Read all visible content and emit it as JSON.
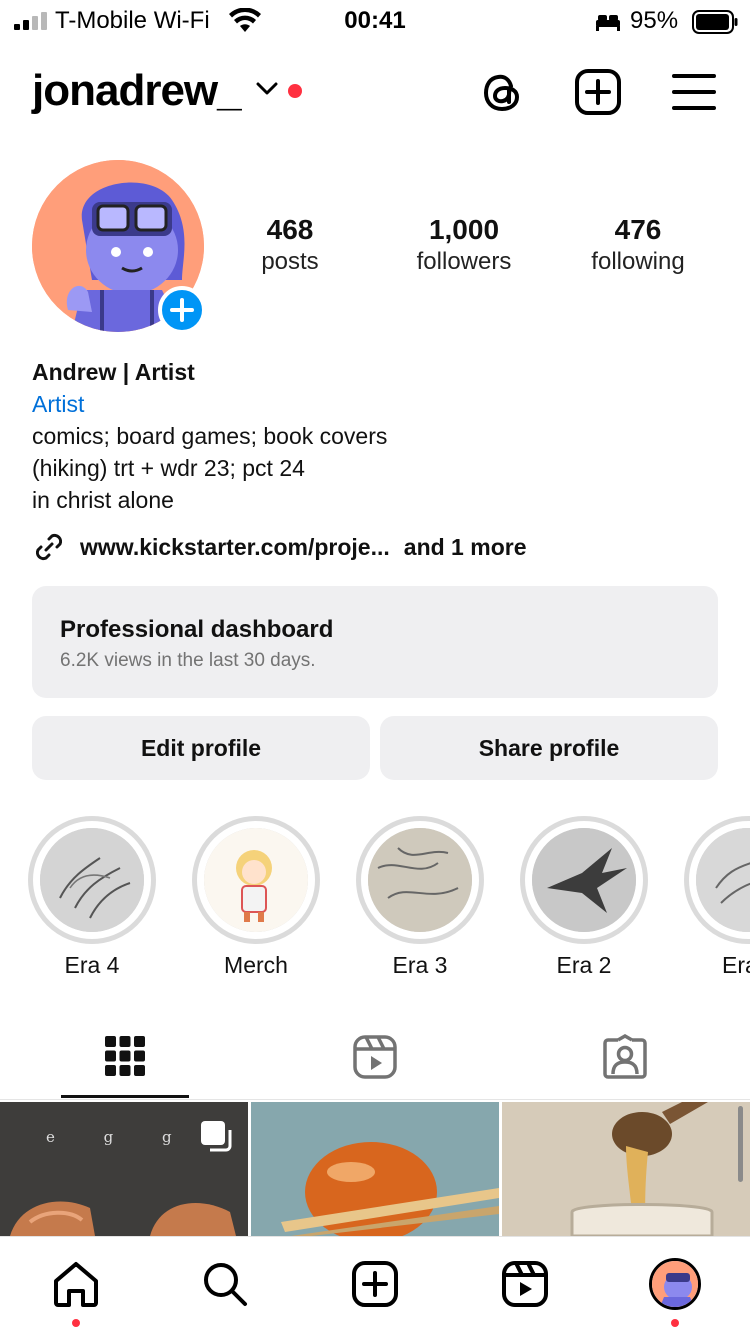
{
  "status_bar": {
    "carrier": "T-Mobile Wi-Fi",
    "time": "00:41",
    "battery": "95%"
  },
  "header": {
    "username": "jonadrew_"
  },
  "stats": [
    {
      "value": "468",
      "label": "posts"
    },
    {
      "value": "1,000",
      "label": "followers"
    },
    {
      "value": "476",
      "label": "following"
    }
  ],
  "bio": {
    "name": "Andrew | Artist",
    "category": "Artist",
    "lines": [
      "comics; board games; book covers",
      "(hiking) trt + wdr 23; pct 24",
      "in christ alone"
    ],
    "link": "www.kickstarter.com/proje...",
    "link_more": "and 1 more"
  },
  "dashboard": {
    "title": "Professional dashboard",
    "subtitle": "6.2K views in the last 30 days."
  },
  "buttons": {
    "edit": "Edit profile",
    "share": "Share profile"
  },
  "highlights": [
    {
      "label": "Era 4"
    },
    {
      "label": "Merch"
    },
    {
      "label": "Era 3"
    },
    {
      "label": "Era 2"
    },
    {
      "label": "Era"
    }
  ],
  "grid_posts": [
    {
      "caption": "e g g"
    },
    {
      "caption": ""
    },
    {
      "caption": ""
    }
  ],
  "colors": {
    "accent_blue": "#0095f6",
    "link_blue": "#0070d9",
    "notification_red": "#ff3040",
    "button_bg": "#efeff1"
  },
  "icons": {
    "header": [
      "threads-icon",
      "create-icon",
      "menu-icon"
    ],
    "tabs": [
      "grid-icon",
      "reels-icon",
      "tagged-icon"
    ],
    "nav": [
      "home-icon",
      "search-icon",
      "create-icon",
      "reels-icon",
      "profile-avatar"
    ]
  }
}
